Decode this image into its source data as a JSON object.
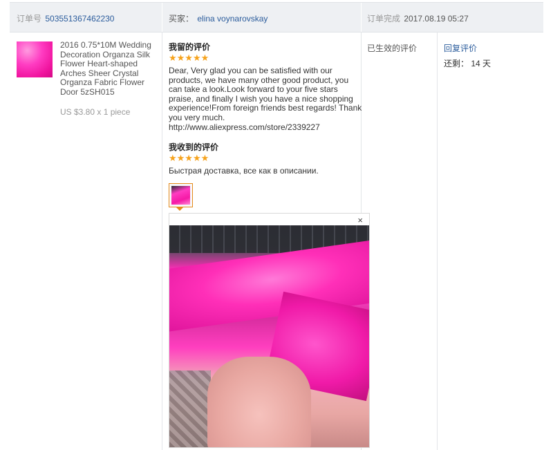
{
  "header": {
    "order_label": "订单号",
    "order_number": "503551367462230",
    "buyer_label": "买家：",
    "buyer_name": "elina voynarovskay",
    "completed_label": "订单完成",
    "completed_time": "2017.08.19 05:27"
  },
  "product": {
    "title": "2016 0.75*10M Wedding Decoration Organza Silk Flower Heart-shaped Arches Sheer Crystal Organza Fabric Flower Door 5zSH015",
    "price": "US $3.80 x 1 piece"
  },
  "my_review": {
    "title": "我留的评价",
    "stars": "★★★★★",
    "rating": 5,
    "text": "Dear, Very glad you can be satisfied with our products, we have many other good product, you can take a look.Look forward to your five stars praise, and finally I wish you have a nice shopping experience!From foreign friends best regards! Thank you very much.\nhttp://www.aliexpress.com/store/2339227"
  },
  "received_review": {
    "title": "我收到的评价",
    "stars": "★★★★★",
    "rating": 5,
    "text": "Быстрая доставка, все как в описании."
  },
  "popup": {
    "close": "×"
  },
  "status": {
    "label": "已生效的评价"
  },
  "actions": {
    "reply": "回复评价",
    "remaining": "还剩： 14 天"
  },
  "colors": {
    "link": "#2b5c9c",
    "star": "#f6a21b",
    "header_bg": "#eef0f3"
  },
  "icons": {
    "star": "star-icon",
    "close": "close-icon"
  }
}
